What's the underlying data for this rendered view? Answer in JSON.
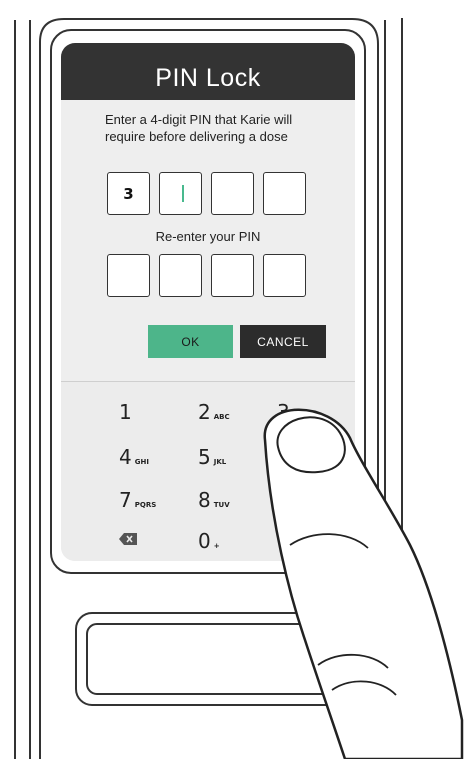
{
  "screen": {
    "title": "PIN Lock",
    "instruction": "Enter a 4-digit PIN that Karie will require before delivering a dose",
    "pin_digits": [
      "3",
      "",
      "",
      ""
    ],
    "reenter_label": "Re-enter your PIN",
    "confirm_digits": [
      "",
      "",
      "",
      ""
    ],
    "ok_label": "OK",
    "cancel_label": "CANCEL"
  },
  "keypad": {
    "keys": [
      {
        "digit": "1",
        "letters": ""
      },
      {
        "digit": "2",
        "letters": "ABC"
      },
      {
        "digit": "3",
        "letters": ""
      },
      {
        "digit": "4",
        "letters": "GHI"
      },
      {
        "digit": "5",
        "letters": "JKL"
      },
      {
        "digit": "7",
        "letters": "PQRS"
      },
      {
        "digit": "8",
        "letters": "TUV"
      },
      {
        "digit": "0",
        "letters": "+"
      }
    ],
    "backspace_icon": "backspace-icon"
  },
  "colors": {
    "title_bar": "#333333",
    "ok_button": "#4db58a",
    "cancel_button": "#2c2c2c",
    "caret": "#49b98e"
  }
}
